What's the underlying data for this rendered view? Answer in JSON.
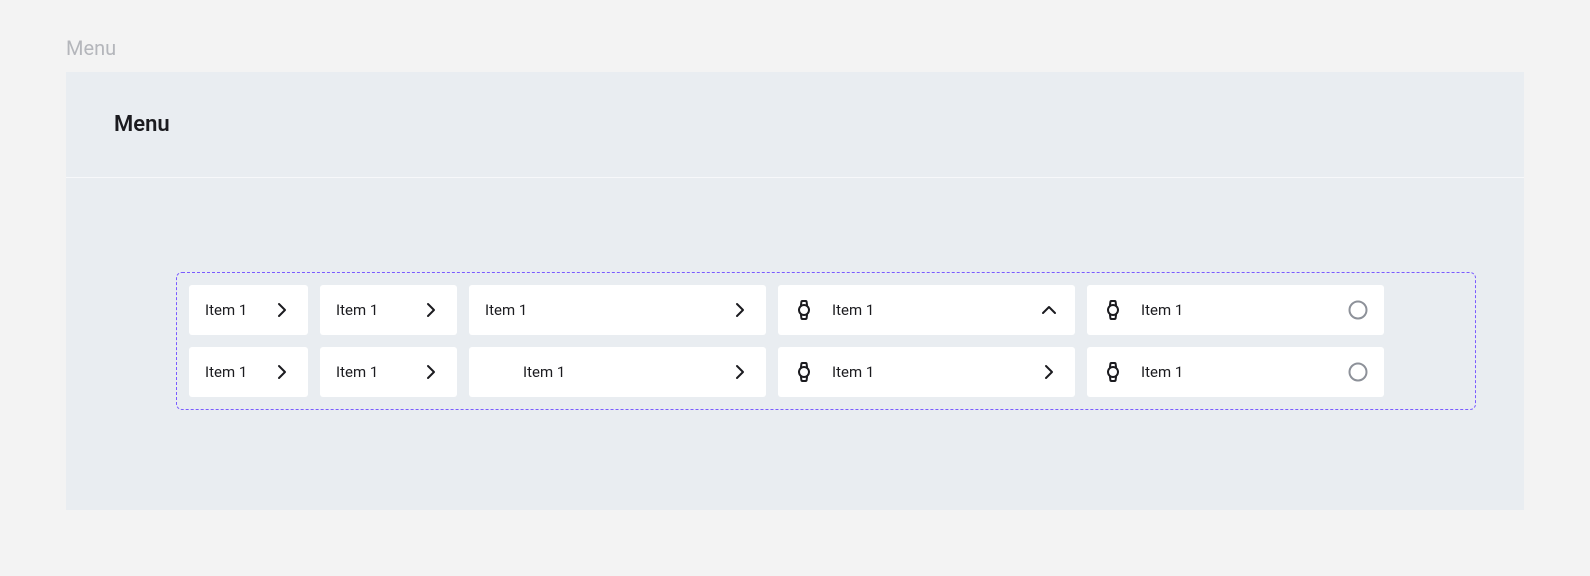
{
  "breadcrumb": "Menu",
  "panel": {
    "title": "Menu"
  },
  "items": {
    "r1c1": {
      "label": "Item 1"
    },
    "r1c2": {
      "label": "Item 1"
    },
    "r1c3": {
      "label": "Item 1"
    },
    "r1c4": {
      "label": "Item 1"
    },
    "r1c5": {
      "label": "Item 1"
    },
    "r2c1": {
      "label": "Item 1"
    },
    "r2c2": {
      "label": "Item 1"
    },
    "r2c3": {
      "label": "Item 1"
    },
    "r2c4": {
      "label": "Item 1"
    },
    "r2c5": {
      "label": "Item 1"
    }
  }
}
